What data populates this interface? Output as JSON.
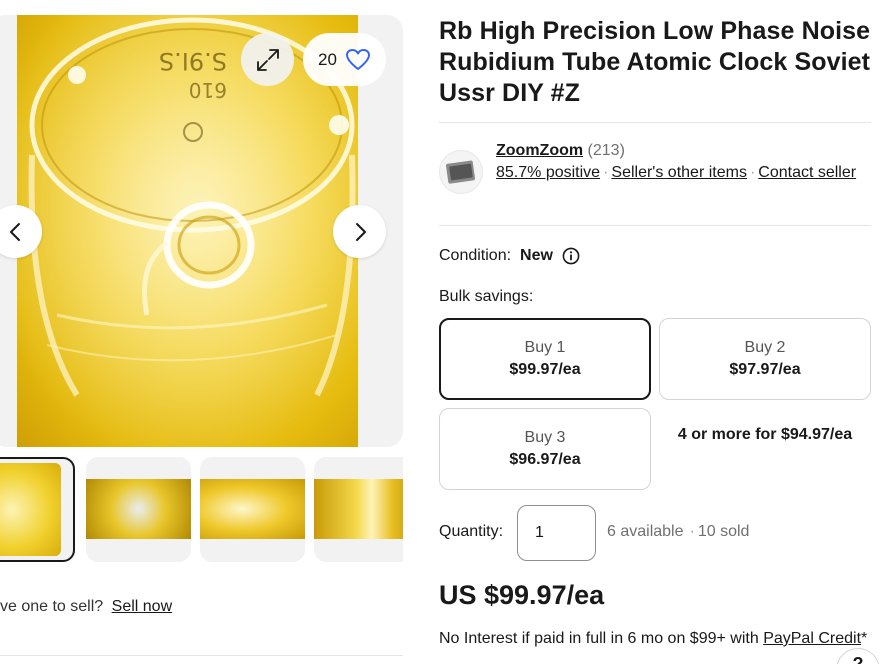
{
  "gallery": {
    "watch_count": "20",
    "icons": {
      "expand": "expand-icon",
      "watch": "heart-icon",
      "prev": "chevron-left-icon",
      "next": "chevron-right-icon"
    },
    "sell_prompt": "ve one to sell?",
    "sell_link": "Sell now"
  },
  "listing": {
    "title": "Rb High Precision Low Phase Noise Rubidium Tube Atomic Clock Soviet Ussr DIY #Z"
  },
  "seller": {
    "name": "ZoomZoom",
    "feedback_count": "(213)",
    "positive": "85.7% positive",
    "other_items": "Seller's other items",
    "contact": "Contact seller"
  },
  "condition": {
    "label": "Condition:",
    "value": "New",
    "icon": "info-icon"
  },
  "bulk": {
    "label": "Bulk savings:",
    "options": [
      {
        "qty": "Buy 1",
        "price": "$99.97/ea"
      },
      {
        "qty": "Buy 2",
        "price": "$97.97/ea"
      },
      {
        "qty": "Buy 3",
        "price": "$96.97/ea"
      }
    ],
    "more": "4 or more for $94.97/ea"
  },
  "quantity": {
    "label": "Quantity:",
    "value": "1",
    "available": "6 available",
    "sold": "10 sold"
  },
  "price": {
    "main": "US $99.97/ea",
    "credit_text": "No Interest if paid in full in 6 mo on $99+ with",
    "credit_link": "PayPal Credit",
    "credit_suffix": "*"
  },
  "colors": {
    "text": "#191919",
    "watch_heart": "#3665f3",
    "photo_yellow": "#f3d23a"
  }
}
